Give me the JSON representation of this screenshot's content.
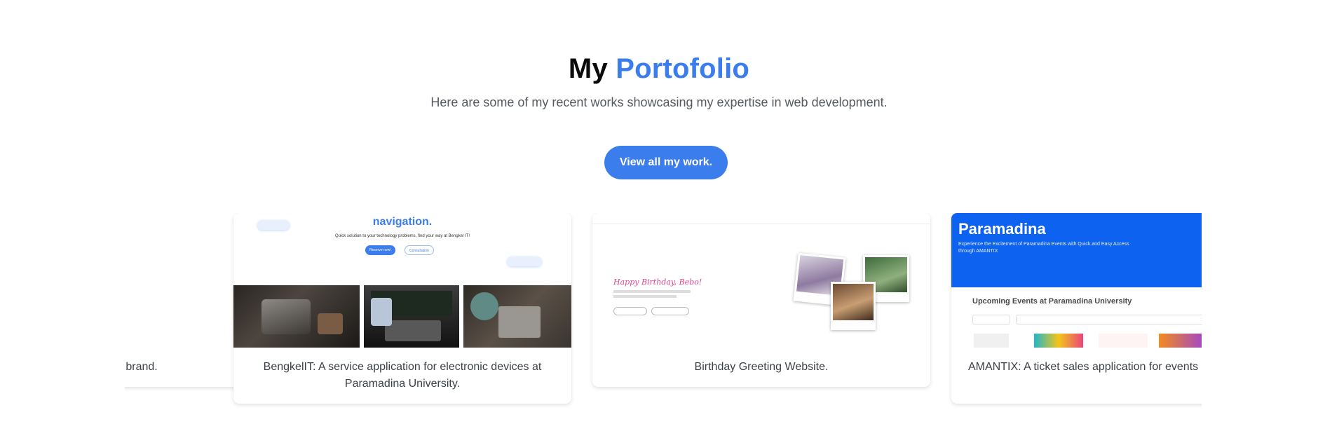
{
  "header": {
    "title_plain": "My",
    "title_accent": "Portofolio",
    "subtitle": "Here are some of my recent works showcasing my expertise in web development.",
    "cta_label": "View all my work."
  },
  "colors": {
    "accent": "#3b7ded",
    "text": "#0b0b0b",
    "muted": "#555a62"
  },
  "projects": [
    {
      "caption": "g brand.",
      "thumb_icon": "fabric-beads-photo"
    },
    {
      "caption": "BengkelIT: A service application for electronic devices at Paramadina University.",
      "thumb_icon": "bengkelit-screenshot",
      "thumb": {
        "headline": "navigation.",
        "subline": "Quick solution to your technology problems, find your way at Bengkel IT!",
        "primary_button": "Reserve now!",
        "secondary_button": "Consultation"
      }
    },
    {
      "caption": "Birthday Greeting Website.",
      "thumb_icon": "birthday-screenshot",
      "thumb": {
        "greeting": "Happy Birthday, Bebo!"
      }
    },
    {
      "caption": "AMANTIX: A ticket sales application for events a University.",
      "thumb_icon": "amantix-screenshot",
      "thumb": {
        "hero_title": "Paramadina",
        "hero_desc": "Experience the Excitement of Paramadina Events with Quick and Easy Access through AMANTIX",
        "section_title": "Upcoming Events at Paramadina University"
      }
    }
  ]
}
